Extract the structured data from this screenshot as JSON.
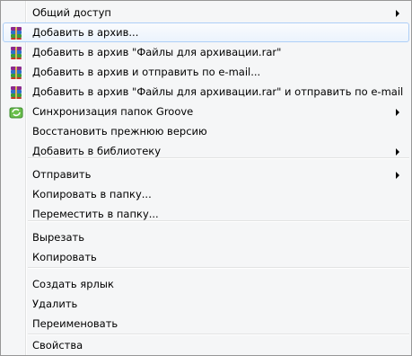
{
  "menu": {
    "items": [
      {
        "label": "Общий доступ",
        "submenu": true,
        "icon": null
      },
      {
        "label": "Добавить в архив...",
        "submenu": false,
        "icon": "winrar-icon",
        "hover": true
      },
      {
        "label": "Добавить в архив \"Файлы для архивации.rar\"",
        "submenu": false,
        "icon": "winrar-icon"
      },
      {
        "label": "Добавить в архив и отправить по e-mail...",
        "submenu": false,
        "icon": "winrar-icon"
      },
      {
        "label": "Добавить в архив \"Файлы для архивации.rar\" и отправить по e-mail",
        "submenu": false,
        "icon": "winrar-icon"
      },
      {
        "label": "Синхронизация папок Groove",
        "submenu": true,
        "icon": "groove-sync-icon"
      },
      {
        "label": "Восстановить прежнюю версию",
        "submenu": false,
        "icon": null
      },
      {
        "label": "Добавить в библиотеку",
        "submenu": true,
        "icon": null
      },
      {
        "label": "Отправить",
        "submenu": true,
        "icon": null
      },
      {
        "label": "Копировать в папку...",
        "submenu": false,
        "icon": null
      },
      {
        "label": "Переместить в папку...",
        "submenu": false,
        "icon": null
      },
      {
        "label": "Вырезать",
        "submenu": false,
        "icon": null
      },
      {
        "label": "Копировать",
        "submenu": false,
        "icon": null
      },
      {
        "label": "Создать ярлык",
        "submenu": false,
        "icon": null
      },
      {
        "label": "Удалить",
        "submenu": false,
        "icon": null
      },
      {
        "label": "Переименовать",
        "submenu": false,
        "icon": null
      },
      {
        "label": "Свойства",
        "submenu": false,
        "icon": null
      }
    ]
  },
  "colors": {
    "menu_background": "#f5f6f7",
    "hover_border": "#aecff7",
    "separator": "#e2e3e3"
  }
}
